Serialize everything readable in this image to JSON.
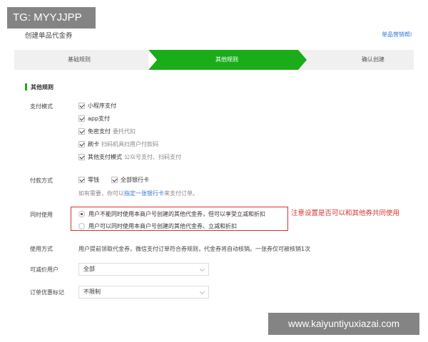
{
  "watermarks": {
    "top_left": "TG: MYYJJPP",
    "bottom_right": "www.kaiyuntiyuxiazai.com"
  },
  "header": {
    "title": "创建单品代金券",
    "help_link": "单品营销帮i"
  },
  "steps": [
    {
      "label": "基础规则",
      "active": false
    },
    {
      "label": "其他规则",
      "active": true
    },
    {
      "label": "确认创建",
      "active": false
    }
  ],
  "section": {
    "title": "其他规则"
  },
  "colors": {
    "accent": "#1aad19",
    "link": "#2d7bd6",
    "warning": "#d9312d"
  },
  "payment_mode": {
    "label": "支付模式",
    "options": [
      {
        "text": "小程序支付",
        "sub": "",
        "checked": true
      },
      {
        "text": "app支付",
        "sub": "",
        "checked": true
      },
      {
        "text": "免密支付",
        "sub": "委托代扣",
        "checked": true
      },
      {
        "text": "刷卡",
        "sub": "扫码机具扫用户付款码",
        "checked": true
      },
      {
        "text": "其他支付模式",
        "sub": "公众号支付、扫码支付",
        "checked": true
      }
    ]
  },
  "pay_method": {
    "label": "付款方式",
    "options": [
      {
        "text": "零钱",
        "checked": true
      },
      {
        "text": "全部银行卡",
        "checked": true
      }
    ],
    "hint_prefix": "如有需要，你可以",
    "hint_link": "指定一张银行卡",
    "hint_suffix": "来支付订单。"
  },
  "concurrent": {
    "label": "同时使用",
    "options": [
      {
        "text": "用户不能同时使用本商户号创建的其他代金券，但可以享受立减和折扣",
        "selected": true
      },
      {
        "text": "用户可以同时使用本商户号创建的其他代金券、立减和折扣",
        "selected": false
      }
    ],
    "annotation": "注意设置是否可以和其他券共同使用"
  },
  "usage": {
    "label": "使用方式",
    "text": "用户提前领取代金券，微信支付订单符合券规则，代金券将自动核销。一张券仅可被核销1次"
  },
  "reducible_users": {
    "label": "可减价用户",
    "value": "全部"
  },
  "order_tag": {
    "label": "订单优惠标记",
    "value": "不限制"
  }
}
